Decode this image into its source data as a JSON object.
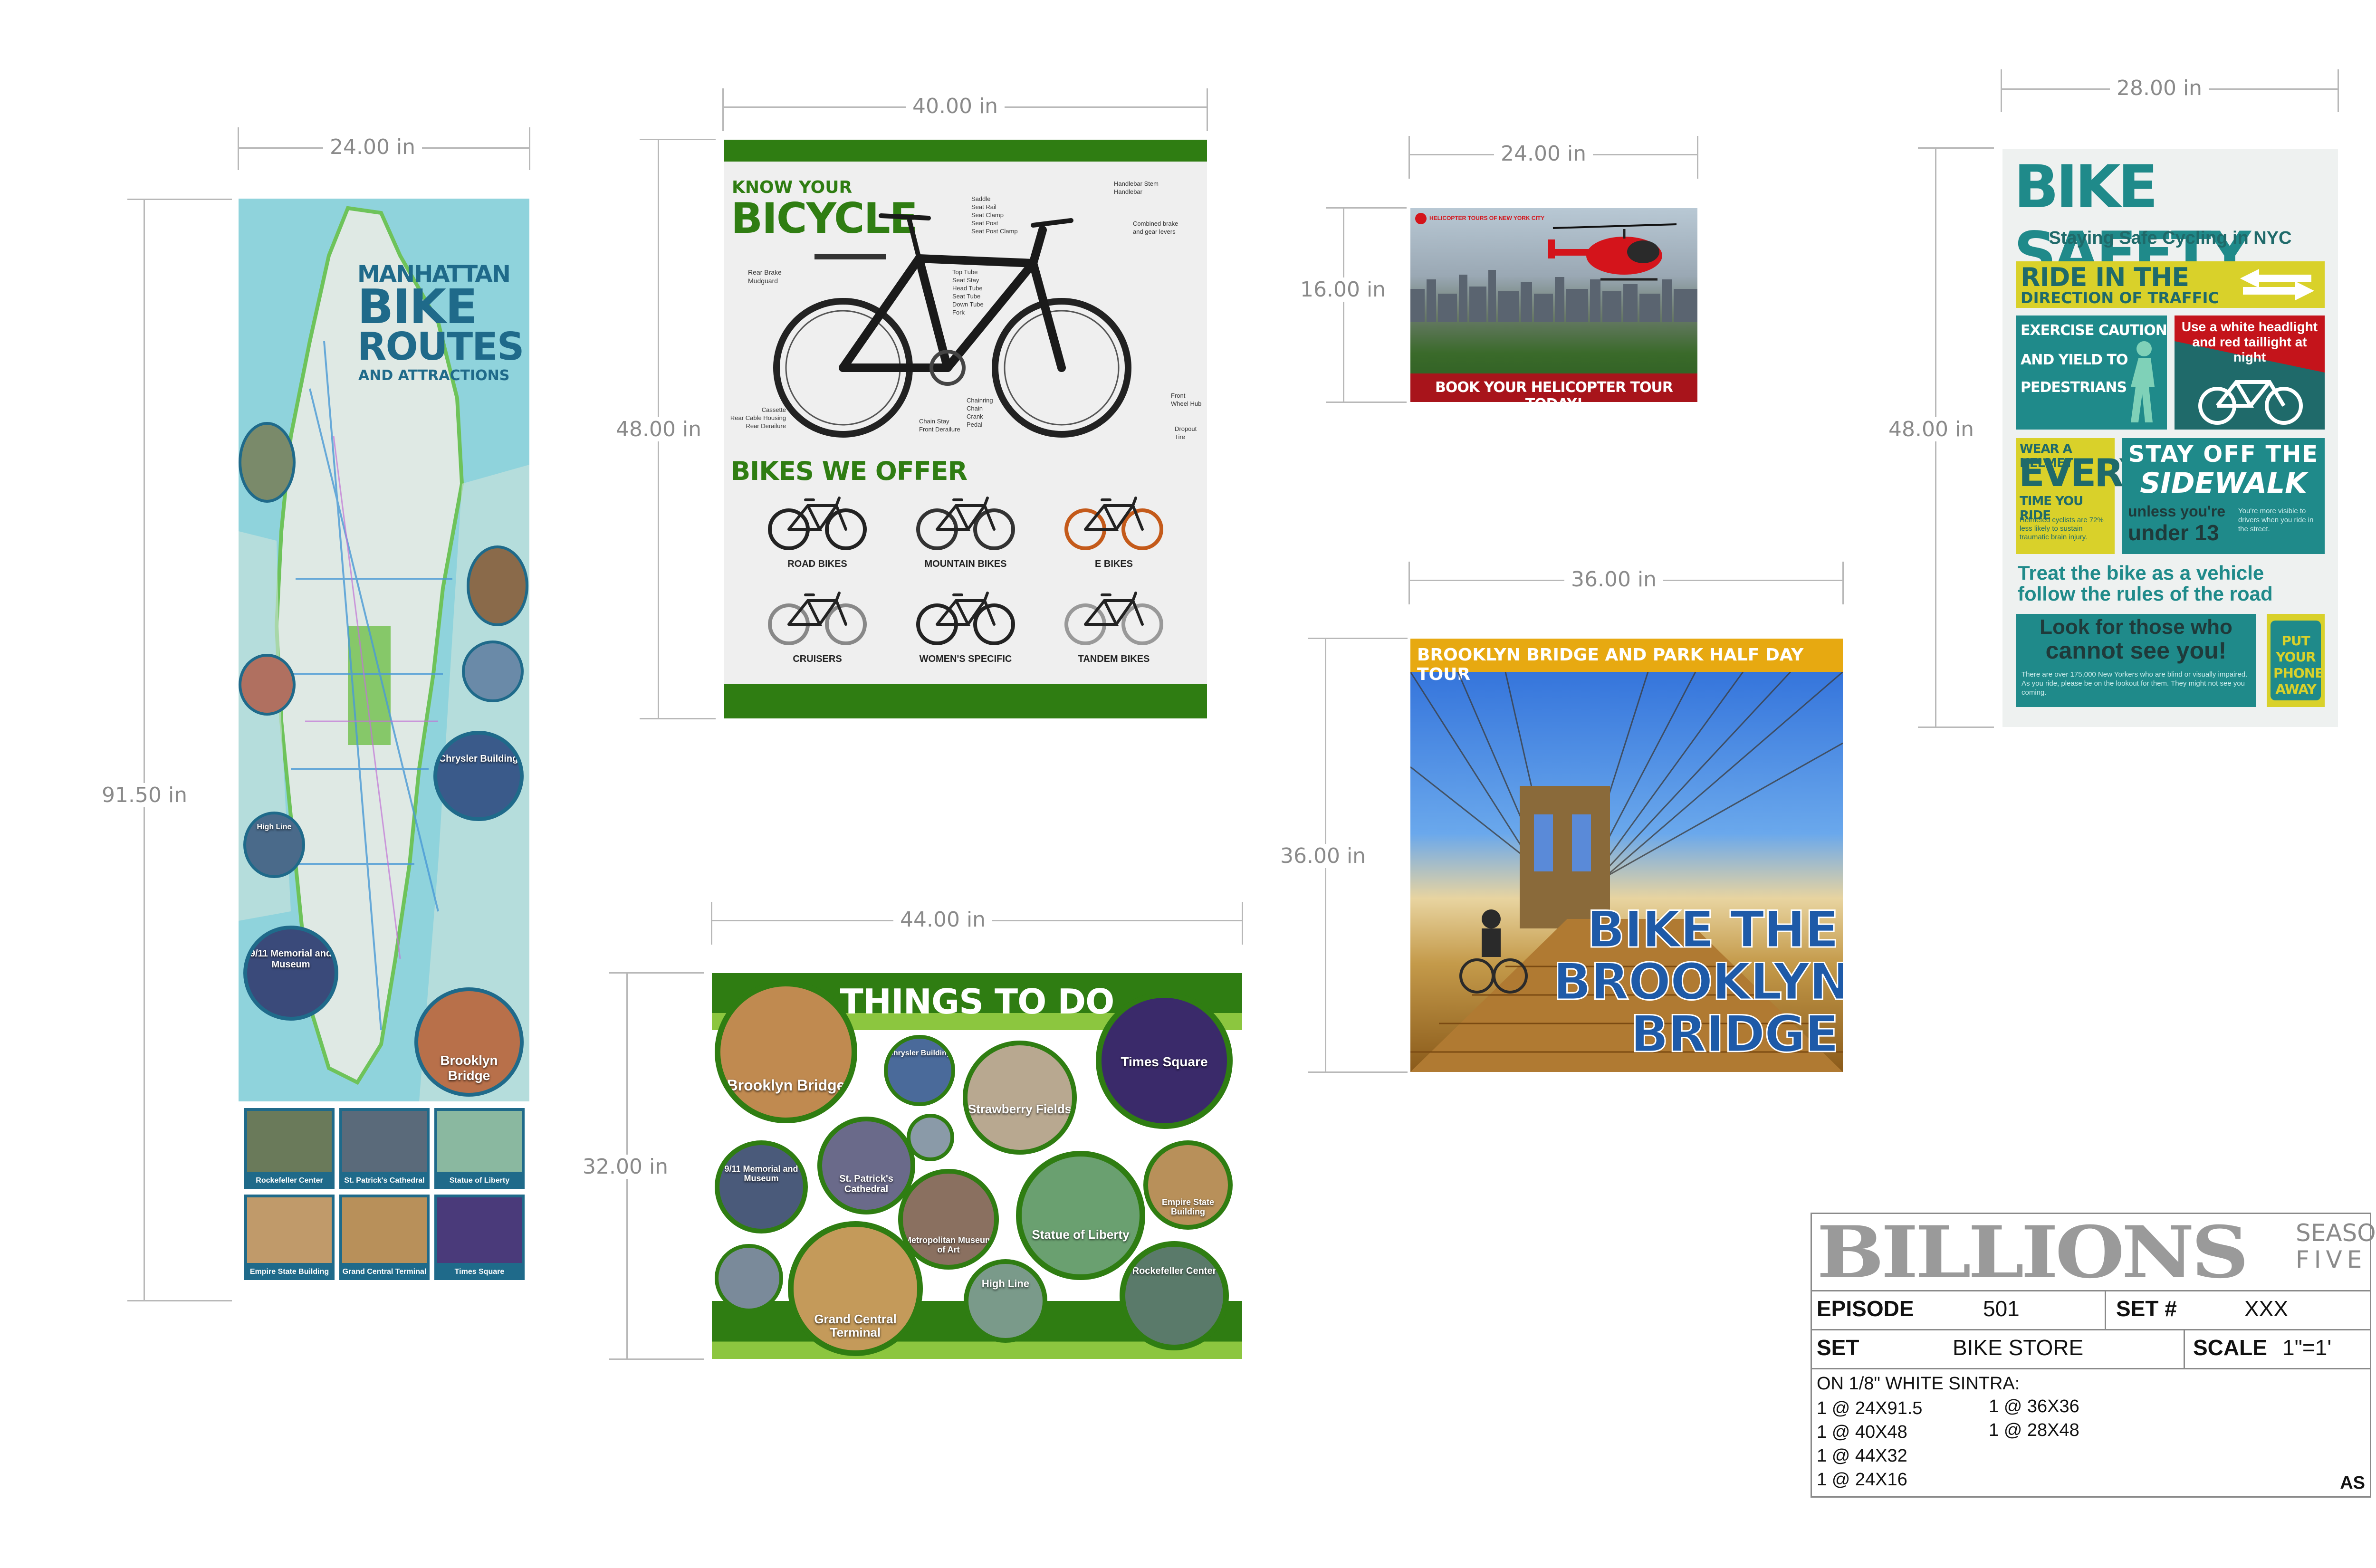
{
  "dimensions": {
    "map_width": "24.00 in",
    "map_height": "91.50 in",
    "bicycle_width": "40.00 in",
    "bicycle_height": "48.00 in",
    "heli_width": "24.00 in",
    "heli_height": "16.00 in",
    "safety_width": "28.00 in",
    "safety_height": "48.00 in",
    "brooklyn_width": "36.00 in",
    "brooklyn_height": "36.00 in",
    "things_width": "44.00 in",
    "things_height": "32.00 in"
  },
  "map_poster": {
    "title_line1": "MANHATTAN",
    "title_line2": "BIKE",
    "title_line3": "ROUTES",
    "title_line4": "AND ATTRACTIONS",
    "circles": [
      "Brooklyn Bridge",
      "Chrysler Building",
      "High Line",
      "9/11 Memorial and Museum"
    ],
    "tiles": [
      "Rockefeller Center",
      "St. Patrick's Cathedral",
      "Statue of Liberty",
      "Empire State Building",
      "Grand Central Terminal",
      "Times Square"
    ]
  },
  "bicycle_poster": {
    "kicker": "KNOW YOUR",
    "title": "BICYCLE",
    "offer_title": "BIKES WE OFFER",
    "bikes": [
      "ROAD BIKES",
      "MOUNTAIN BIKES",
      "E BIKES",
      "CRUISERS",
      "WOMEN'S SPECIFIC",
      "TANDEM BIKES"
    ],
    "parts_left": [
      "Rear Brake",
      "Mudguard",
      "Cassette",
      "Rear Cable Housing",
      "Rear Derailure"
    ],
    "parts_mid": [
      "Saddle",
      "Seat Rail",
      "Seat Clamp",
      "Seat Post",
      "Seat Post Clamp",
      "Top Tube",
      "Seat Stay",
      "Head Tube",
      "Seat Tube",
      "Down Tube",
      "Fork",
      "Chainring",
      "Chain",
      "Crank",
      "Pedal",
      "Chain Stay",
      "Front Derailure"
    ],
    "parts_right": [
      "Handlebar Stem",
      "Handlebar",
      "Combined brake",
      "and gear levers",
      "Front",
      "Wheel Hub",
      "Dropout",
      "Tire"
    ]
  },
  "heli_poster": {
    "brand": "HELICOPTER TOURS OF NEW YORK CITY",
    "cta": "BOOK YOUR HELICOPTER TOUR TODAY!"
  },
  "safety_poster": {
    "title": "BIKE SAFETY",
    "subtitle": "Staying Safe Cycling in NYC",
    "ride_line1": "RIDE IN THE",
    "ride_line2": "DIRECTION OF TRAFFIC",
    "caution_line1": "EXERCISE CAUTION",
    "caution_line2": "AND YIELD TO",
    "caution_line3": "PEDESTRIANS",
    "light_text": "Use a white headlight and red taillight at night",
    "helmet_line1": "WEAR A HELMET",
    "helmet_line2": "EVERY",
    "helmet_line3": "TIME YOU RIDE",
    "helmet_small": "Helmeted cyclists are 72% less likely to sustain traumatic brain injury.",
    "sidewalk_line1": "STAY OFF THE",
    "sidewalk_line2": "SIDEWALK",
    "sidewalk_line3": "unless you're",
    "sidewalk_line4": "under 13",
    "sidewalk_small": "You're more visible to drivers when you ride in the street.",
    "treat_line1": "Treat the bike as a vehicle",
    "treat_line2": "follow the rules of the road",
    "look_line1": "Look for those who",
    "look_line2": "cannot see you!",
    "look_small": "There are over 175,000 New Yorkers who are blind or visually impaired. As you ride, please be on the lookout for them. They might not see you coming.",
    "phone_text": "PUT YOUR PHONE AWAY"
  },
  "brooklyn_poster": {
    "header": "BROOKLYN BRIDGE AND PARK HALF DAY TOUR",
    "line1": "BIKE THE",
    "line2": "BROOKLYN",
    "line3": "BRIDGE"
  },
  "things_poster": {
    "title": "THINGS TO DO",
    "circles": [
      "Brooklyn Bridge",
      "Chrysler Building",
      "Strawberry Fields",
      "Times Square",
      "9/11 Memorial and Museum",
      "St. Patrick's Cathedral",
      "Metropolitan Museum of Art",
      "Statue of Liberty",
      "Empire State Building",
      "Grand Central Terminal",
      "High Line",
      "Rockefeller Center"
    ]
  },
  "title_block": {
    "show": "BILLIONS",
    "season_line1": "SEASON",
    "season_line2": "FIVE",
    "episode_label": "EPISODE",
    "episode_value": "501",
    "set_num_label": "SET #",
    "set_num_value": "XXX",
    "set_label": "SET",
    "set_value": "BIKE STORE",
    "scale_label": "SCALE",
    "scale_value": "1\"=1'",
    "material": "ON 1/8\" WHITE SINTRA:",
    "sizes_col1": [
      "1 @ 24X91.5",
      "1 @ 40X48",
      "1 @ 44X32",
      "1 @ 24X16"
    ],
    "sizes_col2": [
      "1 @ 36X36",
      "1 @ 28X48"
    ],
    "initials": "AS"
  },
  "colors": {
    "map_teal": "#8fd3dc",
    "map_land": "#dfe9e4",
    "green_dark": "#2f7d12",
    "green_light": "#8cc63f",
    "safety_teal": "#1f8a8a",
    "safety_yellow": "#d9d12a",
    "brooklyn_gold": "#e7a911",
    "brooklyn_blue": "#1e5aa8",
    "heli_red": "#a8141b"
  }
}
